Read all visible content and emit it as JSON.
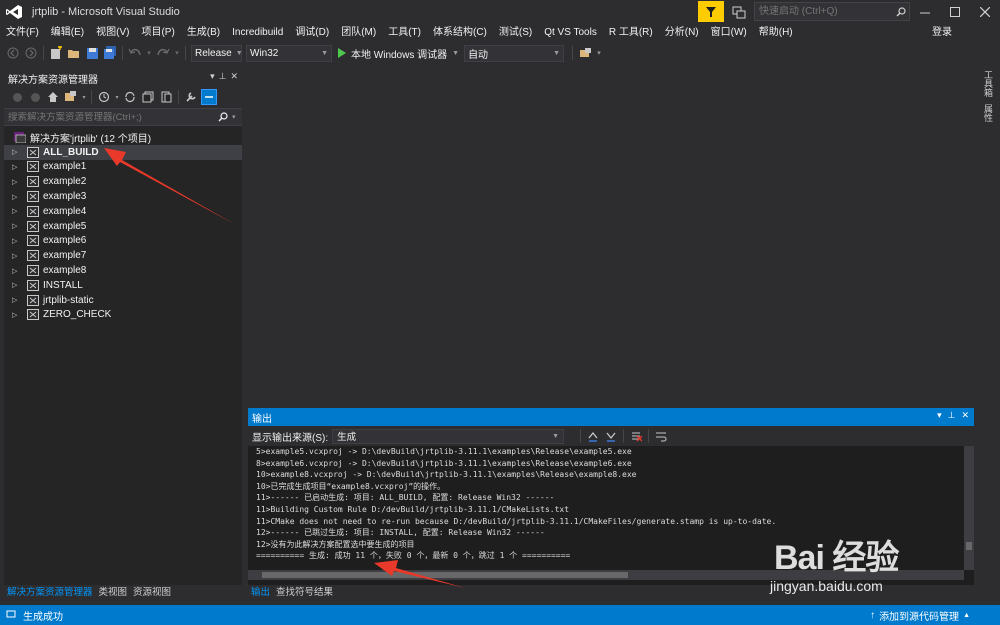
{
  "window": {
    "title": "jrtplib - Microsoft Visual Studio",
    "quick_launch_placeholder": "快速启动 (Ctrl+Q)"
  },
  "menu": {
    "items": [
      "文件(F)",
      "编辑(E)",
      "视图(V)",
      "项目(P)",
      "生成(B)",
      "Incredibuild",
      "调试(D)",
      "团队(M)",
      "工具(T)",
      "体系结构(C)",
      "测试(S)",
      "Qt VS Tools",
      "R 工具(R)",
      "分析(N)",
      "窗口(W)",
      "帮助(H)"
    ],
    "signin": "登录"
  },
  "toolbar": {
    "config": "Release",
    "platform": "Win32",
    "run_label": "本地 Windows 调试器",
    "run_mode": "自动"
  },
  "right_strip": {
    "tabs": [
      "工具箱",
      "属性"
    ]
  },
  "solution_explorer": {
    "title": "解决方案资源管理器",
    "search_placeholder": "搜索解决方案资源管理器(Ctrl+;)",
    "root_label": "解决方案'jrtplib' (12 个项目)",
    "items": [
      "ALL_BUILD",
      "example1",
      "example2",
      "example3",
      "example4",
      "example5",
      "example6",
      "example7",
      "example8",
      "INSTALL",
      "jrtplib-static",
      "ZERO_CHECK"
    ],
    "selected_index": 0,
    "bottom_tabs": [
      "解决方案资源管理器",
      "类视图",
      "资源视图"
    ]
  },
  "output": {
    "title": "输出",
    "source_label": "显示输出来源(S):",
    "source_value": "生成",
    "lines": [
      "5>example5.vcxproj -> D:\\devBuild\\jrtplib-3.11.1\\examples\\Release\\example5.exe",
      "8>example6.vcxproj -> D:\\devBuild\\jrtplib-3.11.1\\examples\\Release\\example6.exe",
      "10>example8.vcxproj -> D:\\devBuild\\jrtplib-3.11.1\\examples\\Release\\example8.exe",
      "10>已完成生成项目“example8.vcxproj”的操作。",
      "11>------ 已启动生成: 项目: ALL_BUILD, 配置: Release Win32 ------",
      "11>Building Custom Rule D:/devBuild/jrtplib-3.11.1/CMakeLists.txt",
      "11>CMake does not need to re-run because D:/devBuild/jrtplib-3.11.1/CMakeFiles/generate.stamp is up-to-date.",
      "12>------ 已跳过生成: 项目: INSTALL, 配置: Release Win32 ------",
      "12>没有为此解决方案配置选中要生成的项目",
      "========== 生成: 成功 11 个，失败 0 个，最新 0 个，跳过 1 个 =========="
    ],
    "bottom_tabs": [
      "输出",
      "查找符号结果"
    ]
  },
  "status": {
    "left": "生成成功",
    "right": "添加到源代码管理"
  },
  "watermark": {
    "brand": "Bai 经验",
    "url": "jingyan.baidu.com"
  },
  "colors": {
    "accent": "#007acc",
    "background": "#2d2d30",
    "panel": "#252526",
    "annotation_arrow": "#e8392a",
    "filter_yellow": "#ffcc00"
  }
}
